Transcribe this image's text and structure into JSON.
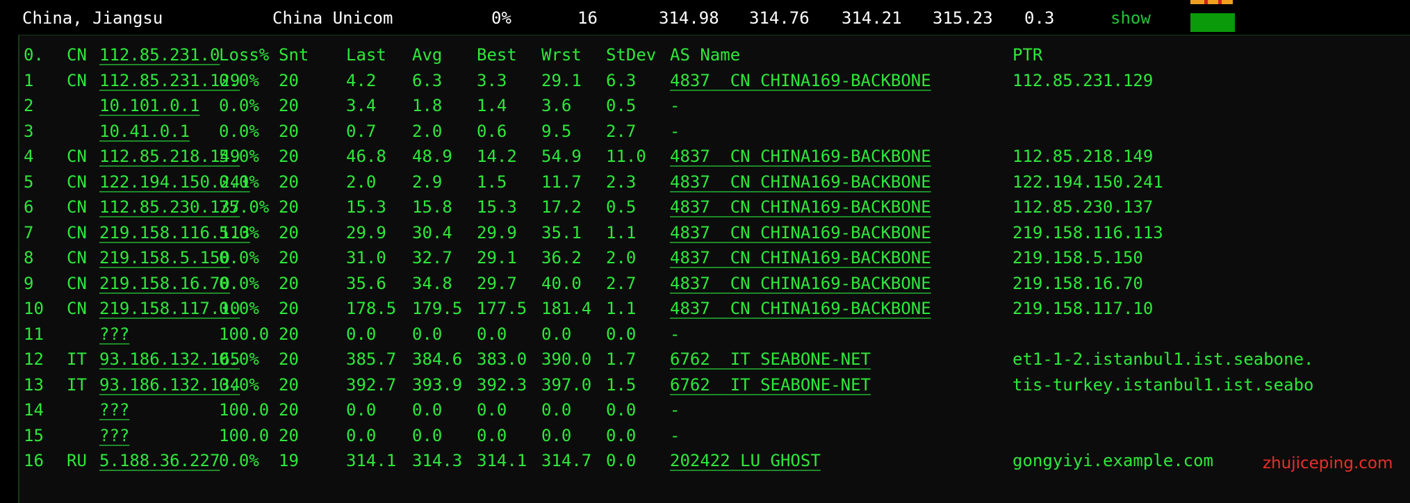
{
  "summary": {
    "location": "China, Jiangsu",
    "isp": "China Unicom",
    "loss": "0%",
    "sent": "16",
    "last": "314.98",
    "avg": "314.76",
    "best": "314.21",
    "worst": "315.23",
    "stdev": "0.3",
    "show_label": "show"
  },
  "header": {
    "hop": "0.",
    "cc": "CN",
    "host": "112.85.231.0",
    "loss": "Loss%",
    "snt": "Snt",
    "last": "Last",
    "avg": "Avg",
    "best": "Best",
    "wrst": "Wrst",
    "stdev": "StDev",
    "as_name": "AS Name",
    "ptr": "PTR"
  },
  "hops": [
    {
      "hop": "1",
      "cc": "CN",
      "host": "112.85.231.129",
      "loss": "0.0%",
      "snt": "20",
      "last": "4.2",
      "avg": "6.3",
      "best": "3.3",
      "wrst": "29.1",
      "stdev": "6.3",
      "asn": "4837",
      "as_cc": "CN",
      "as_name": "CHINA169-BACKBONE",
      "ptr": "112.85.231.129"
    },
    {
      "hop": "2",
      "cc": "",
      "host": "10.101.0.1",
      "loss": "0.0%",
      "snt": "20",
      "last": "3.4",
      "avg": "1.8",
      "best": "1.4",
      "wrst": "3.6",
      "stdev": "0.5",
      "asn": "-",
      "as_cc": "",
      "as_name": "",
      "ptr": ""
    },
    {
      "hop": "3",
      "cc": "",
      "host": "10.41.0.1",
      "loss": "0.0%",
      "snt": "20",
      "last": "0.7",
      "avg": "2.0",
      "best": "0.6",
      "wrst": "9.5",
      "stdev": "2.7",
      "asn": "-",
      "as_cc": "",
      "as_name": "",
      "ptr": ""
    },
    {
      "hop": "4",
      "cc": "CN",
      "host": "112.85.218.149",
      "loss": "5.0%",
      "snt": "20",
      "last": "46.8",
      "avg": "48.9",
      "best": "14.2",
      "wrst": "54.9",
      "stdev": "11.0",
      "asn": "4837",
      "as_cc": "CN",
      "as_name": "CHINA169-BACKBONE",
      "ptr": "112.85.218.149"
    },
    {
      "hop": "5",
      "cc": "CN",
      "host": "122.194.150.241",
      "loss": "0.0%",
      "snt": "20",
      "last": "2.0",
      "avg": "2.9",
      "best": "1.5",
      "wrst": "11.7",
      "stdev": "2.3",
      "asn": "4837",
      "as_cc": "CN",
      "as_name": "CHINA169-BACKBONE",
      "ptr": "122.194.150.241"
    },
    {
      "hop": "6",
      "cc": "CN",
      "host": "112.85.230.137",
      "loss": "75.0%",
      "snt": "20",
      "last": "15.3",
      "avg": "15.8",
      "best": "15.3",
      "wrst": "17.2",
      "stdev": "0.5",
      "asn": "4837",
      "as_cc": "CN",
      "as_name": "CHINA169-BACKBONE",
      "ptr": "112.85.230.137"
    },
    {
      "hop": "7",
      "cc": "CN",
      "host": "219.158.116.113",
      "loss": "5.0%",
      "snt": "20",
      "last": "29.9",
      "avg": "30.4",
      "best": "29.9",
      "wrst": "35.1",
      "stdev": "1.1",
      "asn": "4837",
      "as_cc": "CN",
      "as_name": "CHINA169-BACKBONE",
      "ptr": "219.158.116.113"
    },
    {
      "hop": "8",
      "cc": "CN",
      "host": "219.158.5.150",
      "loss": "0.0%",
      "snt": "20",
      "last": "31.0",
      "avg": "32.7",
      "best": "29.1",
      "wrst": "36.2",
      "stdev": "2.0",
      "asn": "4837",
      "as_cc": "CN",
      "as_name": "CHINA169-BACKBONE",
      "ptr": "219.158.5.150"
    },
    {
      "hop": "9",
      "cc": "CN",
      "host": "219.158.16.70",
      "loss": "0.0%",
      "snt": "20",
      "last": "35.6",
      "avg": "34.8",
      "best": "29.7",
      "wrst": "40.0",
      "stdev": "2.7",
      "asn": "4837",
      "as_cc": "CN",
      "as_name": "CHINA169-BACKBONE",
      "ptr": "219.158.16.70"
    },
    {
      "hop": "10",
      "cc": "CN",
      "host": "219.158.117.10",
      "loss": "0.0%",
      "snt": "20",
      "last": "178.5",
      "avg": "179.5",
      "best": "177.5",
      "wrst": "181.4",
      "stdev": "1.1",
      "asn": "4837",
      "as_cc": "CN",
      "as_name": "CHINA169-BACKBONE",
      "ptr": "219.158.117.10"
    },
    {
      "hop": "11",
      "cc": "",
      "host": "???",
      "loss": "100.0",
      "snt": "20",
      "last": "0.0",
      "avg": "0.0",
      "best": "0.0",
      "wrst": "0.0",
      "stdev": "0.0",
      "asn": "-",
      "as_cc": "",
      "as_name": "",
      "ptr": ""
    },
    {
      "hop": "12",
      "cc": "IT",
      "host": "93.186.132.165",
      "loss": "0.0%",
      "snt": "20",
      "last": "385.7",
      "avg": "384.6",
      "best": "383.0",
      "wrst": "390.0",
      "stdev": "1.7",
      "asn": "6762",
      "as_cc": "IT",
      "as_name": "SEABONE-NET",
      "ptr": "et1-1-2.istanbul1.ist.seabone."
    },
    {
      "hop": "13",
      "cc": "IT",
      "host": "93.186.132.134",
      "loss": "0.0%",
      "snt": "20",
      "last": "392.7",
      "avg": "393.9",
      "best": "392.3",
      "wrst": "397.0",
      "stdev": "1.5",
      "asn": "6762",
      "as_cc": "IT",
      "as_name": "SEABONE-NET",
      "ptr": "tis-turkey.istanbul1.ist.seabo"
    },
    {
      "hop": "14",
      "cc": "",
      "host": "???",
      "loss": "100.0",
      "snt": "20",
      "last": "0.0",
      "avg": "0.0",
      "best": "0.0",
      "wrst": "0.0",
      "stdev": "0.0",
      "asn": "-",
      "as_cc": "",
      "as_name": "",
      "ptr": ""
    },
    {
      "hop": "15",
      "cc": "",
      "host": "???",
      "loss": "100.0",
      "snt": "20",
      "last": "0.0",
      "avg": "0.0",
      "best": "0.0",
      "wrst": "0.0",
      "stdev": "0.0",
      "asn": "-",
      "as_cc": "",
      "as_name": "",
      "ptr": ""
    },
    {
      "hop": "16",
      "cc": "RU",
      "host": "5.188.36.227",
      "loss": "0.0%",
      "snt": "19",
      "last": "314.1",
      "avg": "314.3",
      "best": "314.1",
      "wrst": "314.7",
      "stdev": "0.0",
      "asn": "202422",
      "as_cc": "LU",
      "as_name": "GHOST",
      "ptr": "gongyiyi.example.com"
    }
  ],
  "watermark": "zhujiceping.com",
  "colors": {
    "terminal_text": "#2ee83a",
    "summary_text": "#ffffff",
    "show_link": "#23c23a",
    "status_block": "#0a9a0a",
    "watermark": "#e8302a"
  }
}
